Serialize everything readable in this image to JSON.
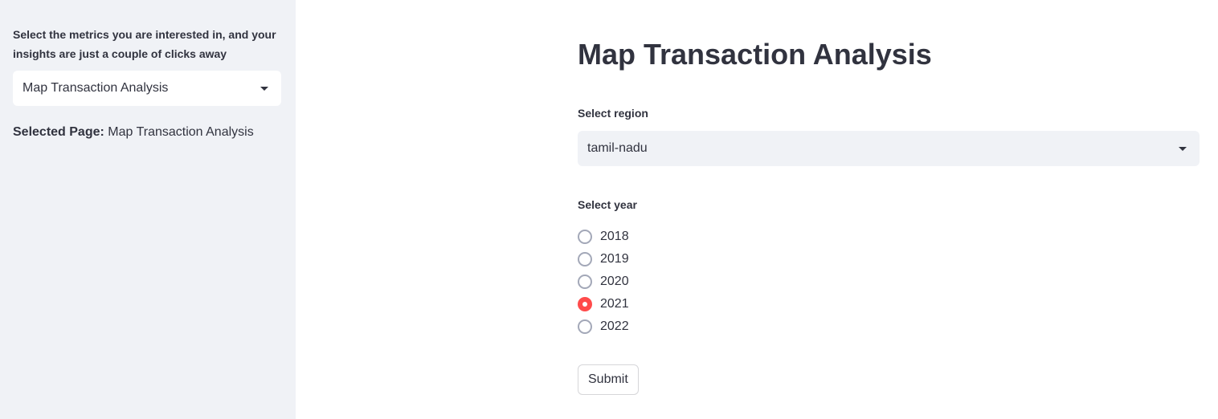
{
  "sidebar": {
    "metrics_prompt": "Select the metrics you are interested in, and your insights are just a couple of clicks away",
    "page_select_value": "Map Transaction Analysis",
    "selected_page_label": "Selected Page:",
    "selected_page_value": "Map Transaction Analysis"
  },
  "main": {
    "title": "Map Transaction Analysis",
    "region": {
      "label": "Select region",
      "value": "tamil-nadu"
    },
    "year": {
      "label": "Select year",
      "options": [
        "2018",
        "2019",
        "2020",
        "2021",
        "2022"
      ],
      "selected": "2021"
    },
    "submit_label": "Submit"
  },
  "colors": {
    "accent": "#ff4b4b",
    "sidebar_bg": "#f0f2f6",
    "text": "#31333f"
  },
  "icons": {
    "dropdown": "chevron-down-icon"
  }
}
